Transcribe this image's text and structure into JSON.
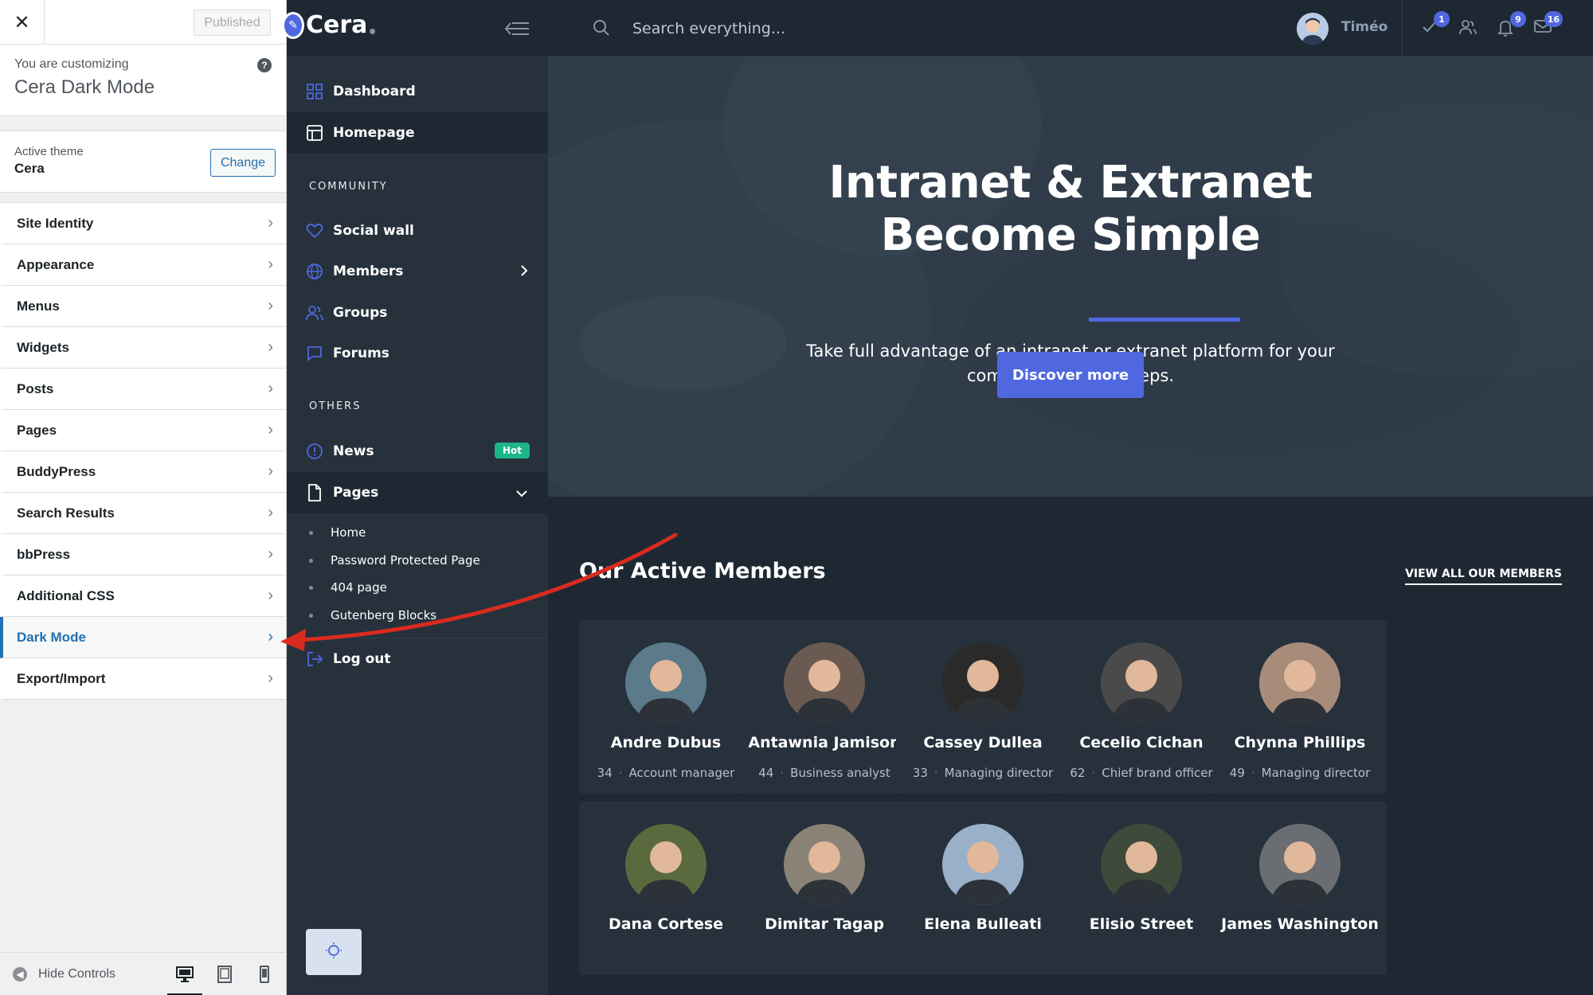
{
  "customizer": {
    "published_label": "Published",
    "customizing_label": "You are customizing",
    "customizing_name": "Cera Dark Mode",
    "active_theme_label": "Active theme",
    "active_theme_name": "Cera",
    "change_label": "Change",
    "menu": [
      {
        "label": "Site Identity"
      },
      {
        "label": "Appearance"
      },
      {
        "label": "Menus"
      },
      {
        "label": "Widgets"
      },
      {
        "label": "Posts"
      },
      {
        "label": "Pages"
      },
      {
        "label": "BuddyPress"
      },
      {
        "label": "Search Results"
      },
      {
        "label": "bbPress"
      },
      {
        "label": "Additional CSS"
      },
      {
        "label": "Dark Mode",
        "active": true
      },
      {
        "label": "Export/Import"
      }
    ],
    "hide_controls_label": "Hide Controls"
  },
  "site": {
    "logo_text": "Cera",
    "search_placeholder": "Search everything...",
    "user_name": "Timéo",
    "badges": {
      "tasks": "1",
      "notifications": "9",
      "messages": "16"
    },
    "sidebar": {
      "dashboard": "Dashboard",
      "homepage": "Homepage",
      "community_heading": "COMMUNITY",
      "social_wall": "Social wall",
      "members": "Members",
      "groups": "Groups",
      "forums": "Forums",
      "others_heading": "OTHERS",
      "news": "News",
      "news_badge": "Hot",
      "pages": "Pages",
      "sub_pages": [
        "Home",
        "Password Protected Page",
        "404 page",
        "Gutenberg Blocks"
      ],
      "logout": "Log out"
    },
    "hero": {
      "title_line1": "Intranet & Extranet",
      "title_line2": "Become Simple",
      "subtitle": "Take full advantage of an intranet or extranet platform for your company. In a few steps.",
      "cta": "Discover more"
    },
    "members_section": {
      "title": "Our Active Members",
      "view_all": "VIEW ALL OUR MEMBERS",
      "members": [
        {
          "name": "Andre Dubus",
          "age": "34",
          "role": "Account manager",
          "color": "#5b7a8a"
        },
        {
          "name": "Antawnia Jamison",
          "age": "44",
          "role": "Business analyst",
          "color": "#6a5a52"
        },
        {
          "name": "Cassey Dullea",
          "age": "33",
          "role": "Managing director",
          "color": "#2a2a2a"
        },
        {
          "name": "Cecelio Cichan",
          "age": "62",
          "role": "Chief brand officer",
          "color": "#4a4a4a"
        },
        {
          "name": "Chynna Phillips",
          "age": "49",
          "role": "Managing director",
          "color": "#a88c7a"
        },
        {
          "name": "Dana Cortese",
          "age": "",
          "role": "",
          "color": "#5a6a3e"
        },
        {
          "name": "Dimitar Tagap",
          "age": "",
          "role": "",
          "color": "#8a8276"
        },
        {
          "name": "Elena Bulleati",
          "age": "",
          "role": "",
          "color": "#9ab0c8"
        },
        {
          "name": "Elisio Street",
          "age": "",
          "role": "",
          "color": "#3e4a3a"
        },
        {
          "name": "James Washington",
          "age": "",
          "role": "",
          "color": "#6a6e72"
        }
      ]
    }
  },
  "colors": {
    "accent": "#4f68e0",
    "wp_blue": "#2271b1",
    "hot": "#1cb588",
    "annotation_arrow": "#d92b1f"
  }
}
